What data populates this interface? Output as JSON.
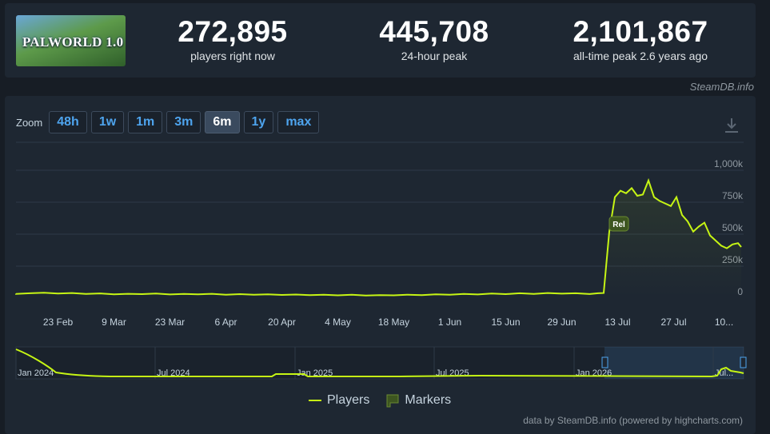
{
  "game": {
    "title": "PALWORLD 1.0"
  },
  "stats": [
    {
      "value": "272,895",
      "label": "players right now"
    },
    {
      "value": "445,708",
      "label": "24-hour peak"
    },
    {
      "value": "2,101,867",
      "label": "all-time peak 2.6 years ago"
    }
  ],
  "credit_top": "SteamDB.info",
  "zoom": {
    "label": "Zoom",
    "options": [
      "48h",
      "1w",
      "1m",
      "3m",
      "6m",
      "1y",
      "max"
    ],
    "selected": "6m"
  },
  "legend": {
    "players": "Players",
    "markers": "Markers"
  },
  "credit_bottom": "data by SteamDB.info (powered by highcharts.com)",
  "colors": {
    "line": "#c6f514",
    "accent": "#4ea4ee",
    "marker": "#3d5520"
  },
  "chart_data": {
    "type": "line",
    "ylim": [
      0,
      1000000
    ],
    "yticks": [
      0,
      250000,
      500000,
      750000,
      1000000
    ],
    "ytick_labels": [
      "0",
      "250k",
      "500k",
      "750k",
      "1,000k"
    ],
    "xtick_labels": [
      "23 Feb",
      "9 Mar",
      "23 Mar",
      "6 Apr",
      "20 Apr",
      "4 May",
      "18 May",
      "1 Jun",
      "15 Jun",
      "29 Jun",
      "13 Jul",
      "27 Jul",
      "10..."
    ],
    "xtick_index": [
      1.5,
      3.5,
      5.5,
      7.5,
      9.5,
      11.5,
      13.5,
      15.5,
      17.5,
      19.5,
      21.5,
      23.5,
      25.3
    ],
    "x_count": 27,
    "marker": {
      "label": "Rel",
      "x_index": 21.2
    },
    "series": [
      {
        "name": "Players",
        "x": [
          -0.3,
          0,
          0.5,
          1,
          1.5,
          2,
          2.5,
          3,
          3.5,
          4,
          4.5,
          5,
          5.5,
          6,
          6.5,
          7,
          7.5,
          8,
          8.5,
          9,
          9.5,
          10,
          10.5,
          11,
          11.5,
          12,
          12.5,
          13,
          13.5,
          14,
          14.5,
          15,
          15.5,
          16,
          16.5,
          17,
          17.5,
          18,
          18.5,
          19,
          19.5,
          20,
          20.5,
          20.8,
          21.0,
          21.2,
          21.4,
          21.6,
          21.8,
          22.0,
          22.2,
          22.4,
          22.6,
          22.8,
          23.0,
          23.2,
          23.4,
          23.6,
          23.8,
          24.0,
          24.2,
          24.4,
          24.6,
          24.8,
          25.0,
          25.2,
          25.4,
          25.6,
          25.8,
          26.0
        ],
        "y": [
          35000,
          33000,
          38000,
          42000,
          36000,
          40000,
          33000,
          37000,
          30000,
          34000,
          31000,
          36000,
          29000,
          33000,
          30000,
          34000,
          27000,
          31000,
          26000,
          30000,
          25000,
          28000,
          23000,
          27000,
          22000,
          26000,
          20000,
          24000,
          22000,
          27000,
          24000,
          30000,
          26000,
          33000,
          29000,
          36000,
          31000,
          38000,
          33000,
          40000,
          35000,
          38000,
          32000,
          38000,
          40000,
          520000,
          790000,
          840000,
          820000,
          860000,
          800000,
          810000,
          920000,
          790000,
          760000,
          740000,
          720000,
          790000,
          650000,
          600000,
          520000,
          560000,
          590000,
          490000,
          450000,
          410000,
          390000,
          420000,
          430000,
          400000
        ]
      }
    ]
  },
  "navigator": {
    "labels": [
      "Jan 2024",
      "Jul 2024",
      "Jan 2025",
      "Jul 2025",
      "Jan 2026",
      "Jul..."
    ]
  }
}
